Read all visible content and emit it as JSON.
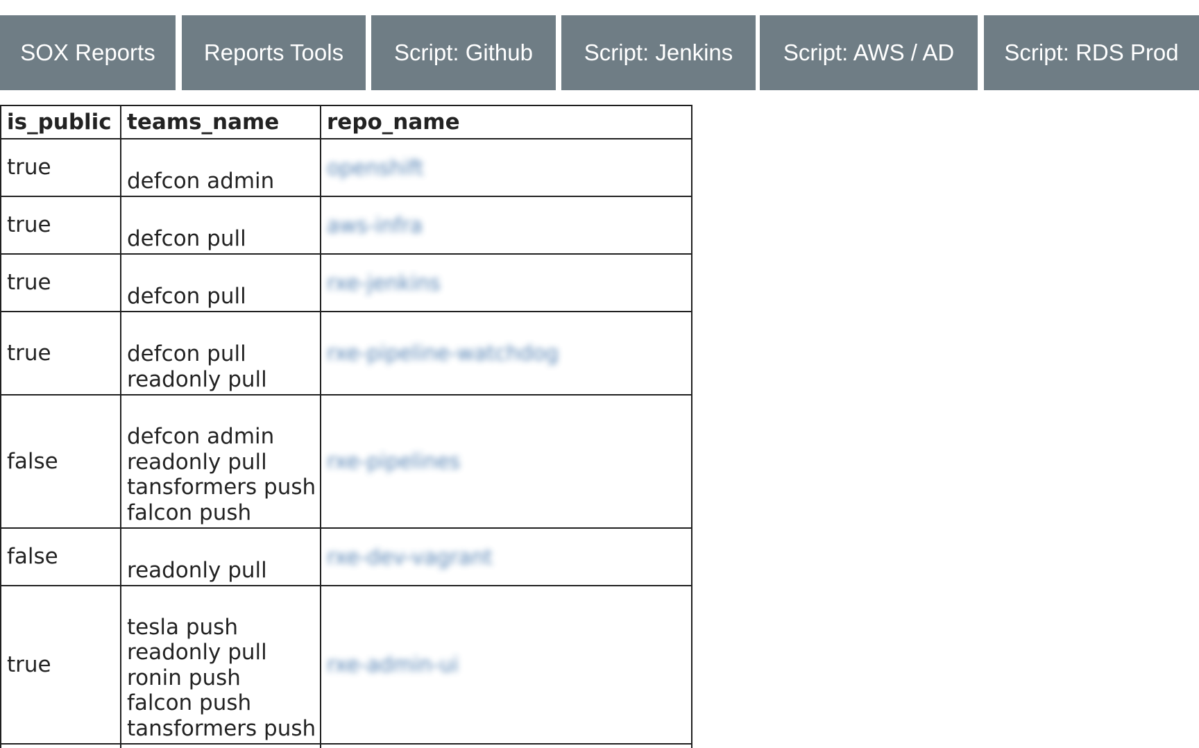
{
  "nav": {
    "items": [
      {
        "label": "SOX Reports"
      },
      {
        "label": "Reports Tools"
      },
      {
        "label": "Script: Github"
      },
      {
        "label": "Script: Jenkins"
      },
      {
        "label": "Script: AWS / AD"
      },
      {
        "label": "Script: RDS Prod"
      }
    ]
  },
  "table": {
    "headers": [
      "is_public",
      "teams_name",
      "repo_name"
    ],
    "rows": [
      {
        "is_public": "true",
        "teams": [
          "defcon admin"
        ],
        "repo": "openshift"
      },
      {
        "is_public": "true",
        "teams": [
          "defcon pull"
        ],
        "repo": "aws-infra"
      },
      {
        "is_public": "true",
        "teams": [
          "defcon pull"
        ],
        "repo": "rxe-jenkins"
      },
      {
        "is_public": "true",
        "teams": [
          "defcon pull",
          "readonly pull"
        ],
        "repo": "rxe-pipeline-watchdog"
      },
      {
        "is_public": "false",
        "teams": [
          "defcon admin",
          "readonly pull",
          "tansformers push",
          "falcon push"
        ],
        "repo": "rxe-pipelines"
      },
      {
        "is_public": "false",
        "teams": [
          "readonly pull"
        ],
        "repo": "rxe-dev-vagrant"
      },
      {
        "is_public": "true",
        "teams": [
          "tesla push",
          "readonly pull",
          "ronin push",
          "falcon push",
          "tansformers push"
        ],
        "repo": "rxe-admin-ui"
      }
    ]
  },
  "colors": {
    "nav_background": "#6f7d85",
    "nav_text": "#ffffff",
    "border": "#1f1f1f",
    "link": "#3a6fa8"
  }
}
